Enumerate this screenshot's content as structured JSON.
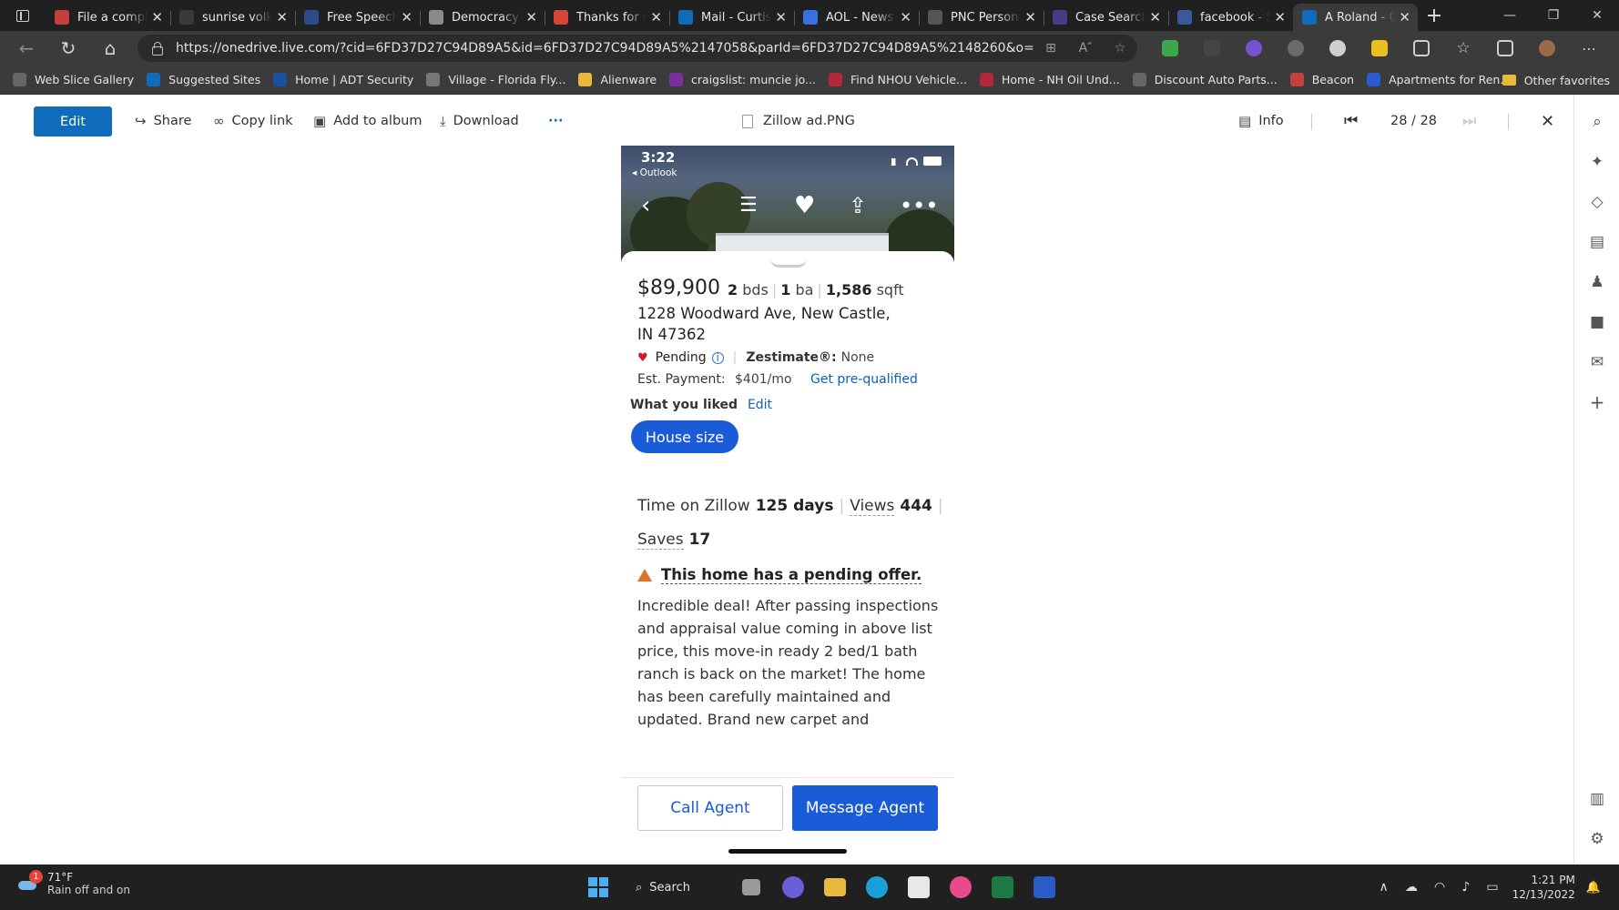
{
  "browser": {
    "tabs": [
      {
        "title": "File a compl",
        "favicon_color": "#c4403b",
        "active": false
      },
      {
        "title": "sunrise volk",
        "favicon_color": "#3a3a3a",
        "active": false
      },
      {
        "title": "Free Speech",
        "favicon_color": "#2d4a8a",
        "active": false
      },
      {
        "title": "Democracy F",
        "favicon_color": "#8a8a8a",
        "active": false
      },
      {
        "title": "Thanks for s",
        "favicon_color": "#d44638",
        "active": false
      },
      {
        "title": "Mail - Curtis",
        "favicon_color": "#0f6cbd",
        "active": false
      },
      {
        "title": "AOL - News",
        "favicon_color": "#3a6fe0",
        "active": false
      },
      {
        "title": "PNC Persona",
        "favicon_color": "#555555",
        "active": false
      },
      {
        "title": "Case Search",
        "favicon_color": "#4a3a8a",
        "active": false
      },
      {
        "title": "facebook - S",
        "favicon_color": "#3b5998",
        "active": false
      },
      {
        "title": "A Roland - O",
        "favicon_color": "#0f6cbd",
        "active": true
      }
    ],
    "new_tab_label": "+",
    "url": "https://onedrive.live.com/?cid=6FD37D27C94D89A5&id=6FD37D27C94D89A5%2147058&parId=6FD37D27C94D89A5%2148260&o=OneUp",
    "favorites": [
      {
        "label": "Web Slice Gallery",
        "icon_color": "#666666"
      },
      {
        "label": "Suggested Sites",
        "icon_color": "#0f6cbd"
      },
      {
        "label": "Home | ADT Security",
        "icon_color": "#1c4fa0"
      },
      {
        "label": "Village - Florida Fly...",
        "icon_color": "#777777"
      },
      {
        "label": "Alienware",
        "icon_color": "#e8b93c"
      },
      {
        "label": "craigslist: muncie jo...",
        "icon_color": "#7a2fa0"
      },
      {
        "label": "Find NHOU Vehicle...",
        "icon_color": "#b0283a"
      },
      {
        "label": "Home - NH Oil Und...",
        "icon_color": "#b0283a"
      },
      {
        "label": "Discount Auto Parts...",
        "icon_color": "#666666"
      },
      {
        "label": "Beacon",
        "icon_color": "#c4403b"
      },
      {
        "label": "Apartments for Ren...",
        "icon_color": "#2a5bd0"
      }
    ],
    "other_favorites": "Other favorites"
  },
  "viewer": {
    "edit_label": "Edit",
    "share_label": "Share",
    "copy_link_label": "Copy link",
    "add_album_label": "Add to album",
    "download_label": "Download",
    "more_label": "···",
    "file_name": "Zillow ad.PNG",
    "info_label": "Info",
    "page_counter": "28 / 28"
  },
  "listing": {
    "time": "3:22",
    "back_app": "◂ Outlook",
    "price": "$89,900",
    "beds": "2",
    "beds_unit": "bds",
    "baths": "1",
    "baths_unit": "ba",
    "sqft": "1,586",
    "sqft_unit": "sqft",
    "address_line1": "1228 Woodward Ave, New Castle,",
    "address_line2": "IN 47362",
    "status": "Pending",
    "zestimate_label": "Zestimate®:",
    "zestimate_value": "None",
    "est_payment_label": "Est. Payment:",
    "est_payment_value": "$401/mo",
    "prequal_link": "Get pre-qualified",
    "liked_label": "What you liked",
    "liked_edit": "Edit",
    "liked_chip": "House size",
    "time_on_zillow_label": "Time on Zillow",
    "time_on_zillow_value": "125 days",
    "views_label": "Views",
    "views_value": "444",
    "saves_label": "Saves",
    "saves_value": "17",
    "pending_notice": "This home has a pending offer.",
    "description": "Incredible deal! After passing inspections and appraisal value coming in above list price, this move-in ready 2 bed/1 bath ranch is back on the market! The home has been carefully maintained and updated. Brand new carpet and",
    "call_agent": "Call Agent",
    "message_agent": "Message Agent"
  },
  "taskbar": {
    "temperature": "71°F",
    "weather_text": "Rain off and on",
    "weather_badge": "1",
    "search_label": "Search",
    "time": "1:21 PM",
    "date": "12/13/2022"
  }
}
